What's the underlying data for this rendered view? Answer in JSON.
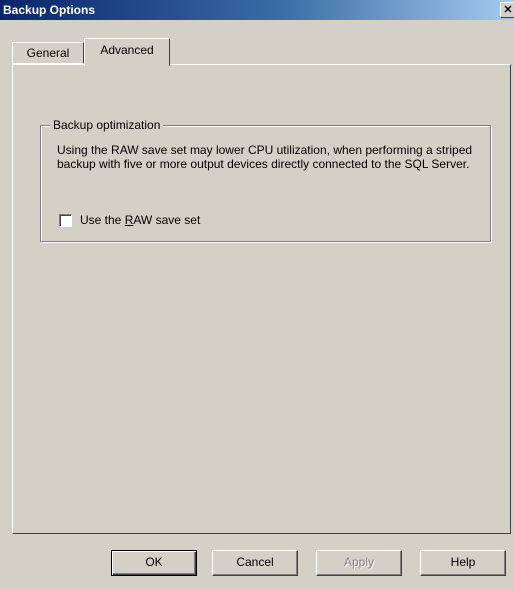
{
  "window": {
    "title": "Backup Options",
    "close_glyph": "✕"
  },
  "tabs": [
    {
      "label": "General",
      "selected": false
    },
    {
      "label": "Advanced",
      "selected": true
    }
  ],
  "group": {
    "title": "Backup optimization",
    "description": "Using the RAW save set may lower CPU utilization, when performing a striped backup with five or more output devices directly connected to the SQL Server.",
    "checkbox": {
      "label_pre": "Use the ",
      "label_accel": "R",
      "label_post": "AW save set",
      "checked": false
    }
  },
  "buttons": {
    "ok": "OK",
    "cancel": "Cancel",
    "apply": "Apply",
    "help": "Help"
  },
  "colors": {
    "titlebar_start": "#0a246a",
    "titlebar_end": "#a6caf0",
    "face": "#d4d0c8"
  }
}
